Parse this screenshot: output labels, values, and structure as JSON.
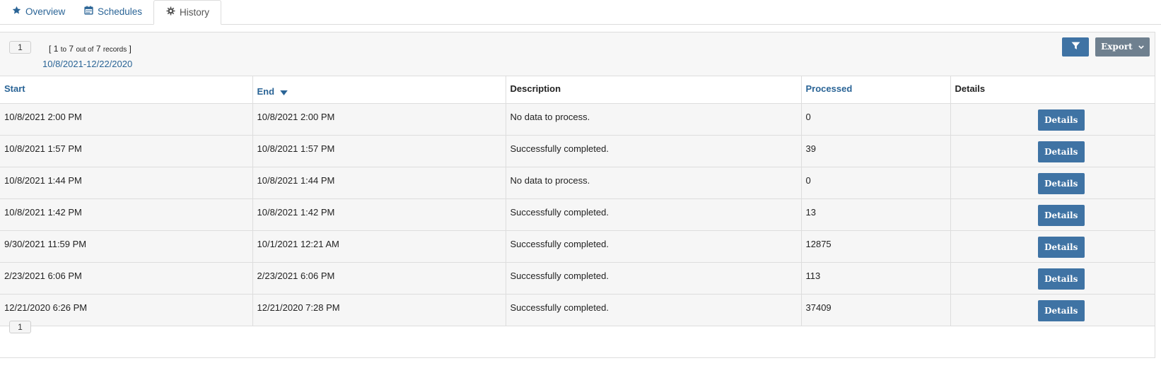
{
  "tabs": [
    {
      "label": "Overview",
      "icon": "star-icon"
    },
    {
      "label": "Schedules",
      "icon": "calendar-icon"
    },
    {
      "label": "History",
      "icon": "gear-icon"
    }
  ],
  "toolbar": {
    "page": "1",
    "records_open": "[",
    "records_from": "1",
    "records_to_word": "to",
    "records_to": "7",
    "records_outof_word": "out of",
    "records_total": "7",
    "records_word": "records",
    "records_close": "]",
    "date_range": "10/8/2021-12/22/2020",
    "filter_icon": "filter-icon",
    "export_label": "Export"
  },
  "accent_color": "#3f73a4",
  "link_color": "#2a6496",
  "table": {
    "columns": [
      "Start",
      "End",
      "Description",
      "Processed",
      "Details"
    ],
    "sort_column": "End",
    "sort_direction": "descending",
    "details_label": "Details",
    "rows": [
      {
        "start": "10/8/2021 2:00 PM",
        "end": "10/8/2021 2:00 PM",
        "description": "No data to process.",
        "processed": "0"
      },
      {
        "start": "10/8/2021 1:57 PM",
        "end": "10/8/2021 1:57 PM",
        "description": "Successfully completed.",
        "processed": "39"
      },
      {
        "start": "10/8/2021 1:44 PM",
        "end": "10/8/2021 1:44 PM",
        "description": "No data to process.",
        "processed": "0"
      },
      {
        "start": "10/8/2021 1:42 PM",
        "end": "10/8/2021 1:42 PM",
        "description": "Successfully completed.",
        "processed": "13"
      },
      {
        "start": "9/30/2021 11:59 PM",
        "end": "10/1/2021 12:21 AM",
        "description": "Successfully completed.",
        "processed": "12875"
      },
      {
        "start": "2/23/2021 6:06 PM",
        "end": "2/23/2021 6:06 PM",
        "description": "Successfully completed.",
        "processed": "113"
      },
      {
        "start": "12/21/2020 6:26 PM",
        "end": "12/21/2020 7:28 PM",
        "description": "Successfully completed.",
        "processed": "37409"
      }
    ]
  },
  "footer": {
    "page": "1"
  }
}
